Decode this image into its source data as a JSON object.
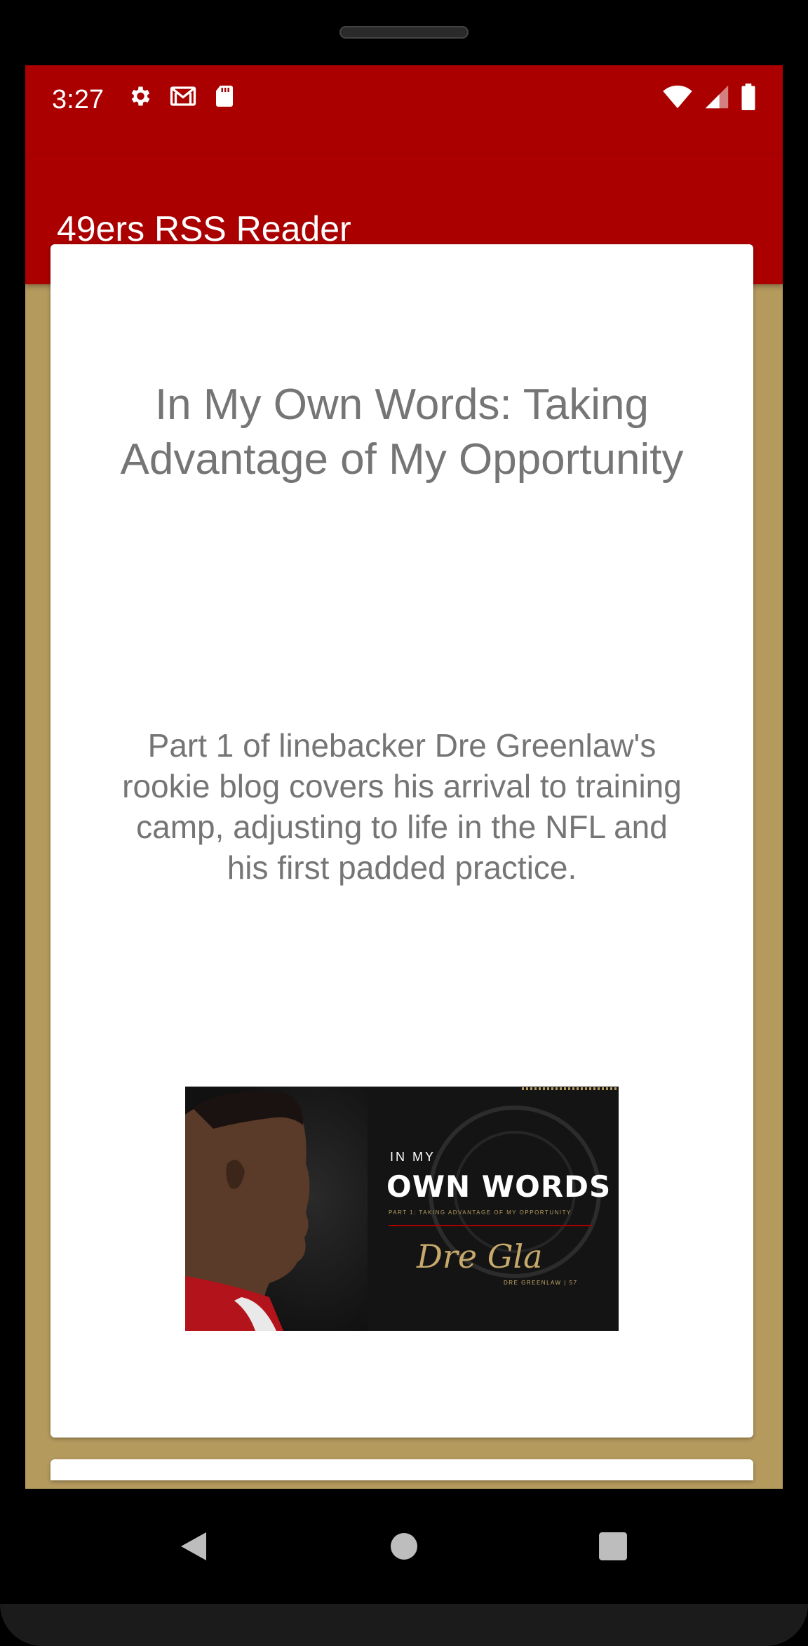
{
  "status_bar": {
    "time": "3:27",
    "left_icons": [
      "gear-icon",
      "gmail-icon",
      "sd-card-icon"
    ],
    "right_icons": [
      "wifi-icon",
      "signal-icon",
      "battery-icon"
    ]
  },
  "app_bar": {
    "title": "49ers RSS Reader"
  },
  "colors": {
    "primary": "#aa0000",
    "background": "#b59a5e",
    "card": "#ffffff",
    "text_secondary": "#757575"
  },
  "feed": {
    "items": [
      {
        "title": "In My Own Words: Taking Advantage of My Opportunity",
        "description": "Part 1 of linebacker Dre Greenlaw's rookie blog covers his arrival to training camp, adjusting to life in the NFL and his first padded practice.",
        "image": {
          "small_text": "IN MY",
          "big_text": "OWN WORDS",
          "subtitle": "PART 1: TAKING ADVANTAGE OF MY OPPORTUNITY",
          "signature": "Dre Gla",
          "byline": "DRE GREENLAW | 57"
        }
      }
    ]
  },
  "nav_bar": {
    "buttons": [
      "back-icon",
      "home-icon",
      "recents-icon"
    ]
  }
}
